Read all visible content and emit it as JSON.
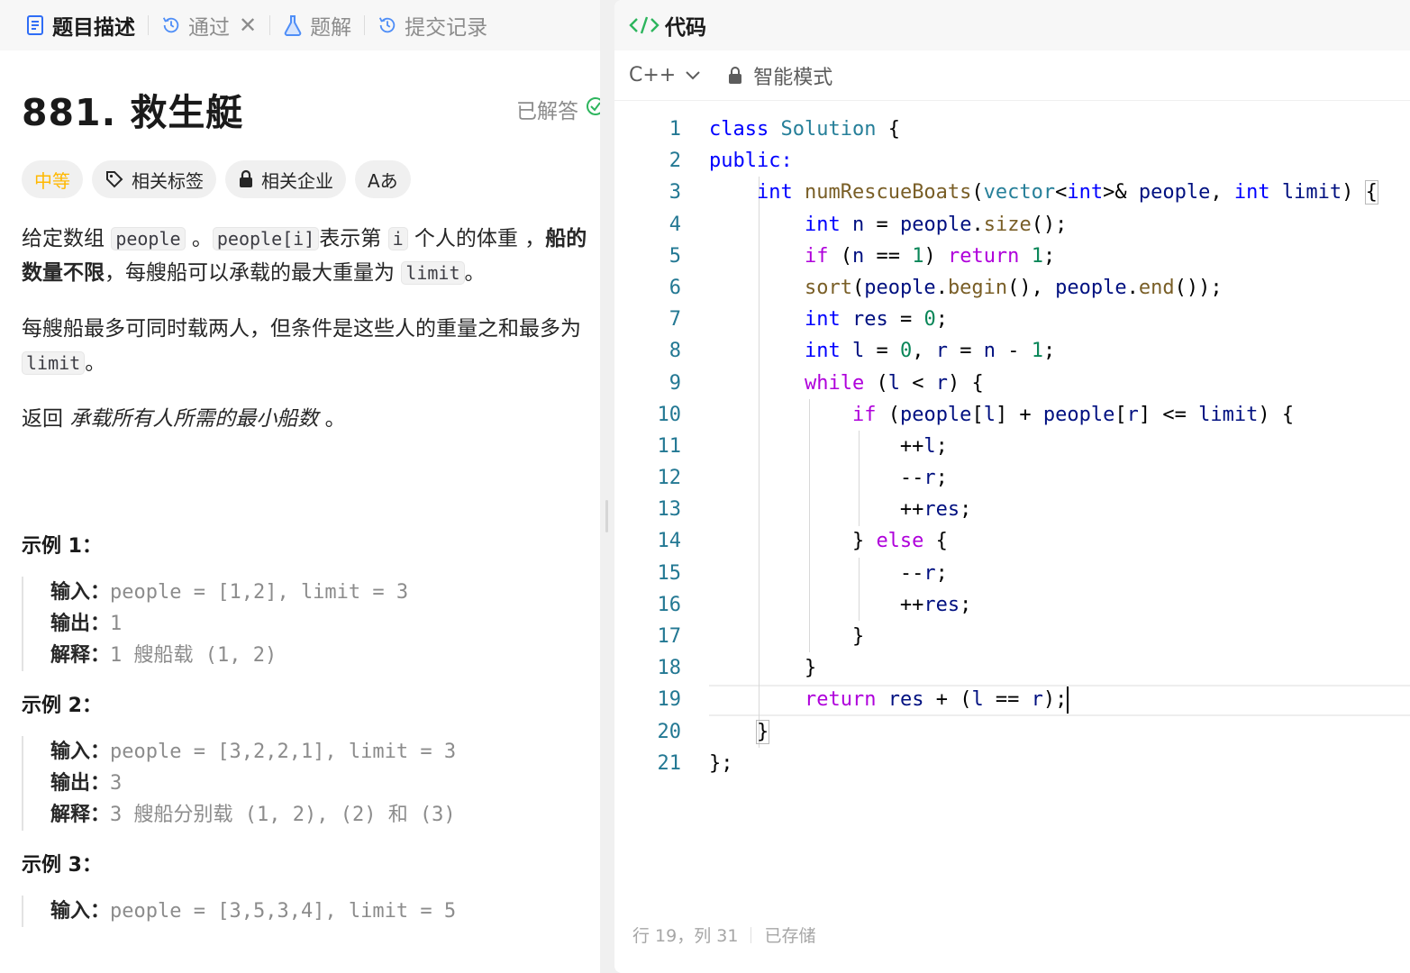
{
  "tabs": [
    {
      "label": "题目描述",
      "icon": "doc-icon"
    },
    {
      "label": "通过",
      "icon": "history-icon"
    },
    {
      "label": "题解",
      "icon": "flask-icon"
    },
    {
      "label": "提交记录",
      "icon": "history-icon"
    }
  ],
  "problem": {
    "title": "881. 救生艇",
    "status": "已解答",
    "difficulty": "中等",
    "tags": [
      "相关标签",
      "相关企业"
    ],
    "translate_icon": "Aあ"
  },
  "description": {
    "p1_a": "给定数组 ",
    "p1_code1": "people",
    "p1_b": " 。",
    "p1_code2": "people[i]",
    "p1_c": "表示第 ",
    "p1_code3": "i",
    "p1_d": " 个人的体重 ，",
    "p1_bold": "船的数量不限",
    "p1_e": "，每艘船可以承载的最大重量为 ",
    "p1_code4": "limit",
    "p1_f": "。",
    "p2_a": "每艘船最多可同时载两人，但条件是这些人的重量之和最多为 ",
    "p2_code": "limit",
    "p2_b": "。",
    "p3_a": "返回 ",
    "p3_italic": "承载所有人所需的最小船数",
    "p3_b": " 。"
  },
  "examples": [
    {
      "title": "示例 1：",
      "input_label": "输入：",
      "input": "people = [1,2], limit = 3",
      "output_label": "输出：",
      "output": "1",
      "explain_label": "解释：",
      "explain": "1 艘船载 (1, 2)"
    },
    {
      "title": "示例 2：",
      "input_label": "输入：",
      "input": "people = [3,2,2,1], limit = 3",
      "output_label": "输出：",
      "output": "3",
      "explain_label": "解释：",
      "explain": "3 艘船分别载 (1, 2), (2) 和 (3)"
    },
    {
      "title": "示例 3：",
      "input_label": "输入：",
      "input": "people = [3,5,3,4], limit = 5"
    }
  ],
  "editor": {
    "header": "代码",
    "language": "C++",
    "mode": "智能模式",
    "line_numbers": [
      "1",
      "2",
      "3",
      "4",
      "5",
      "6",
      "7",
      "8",
      "9",
      "10",
      "11",
      "12",
      "13",
      "14",
      "15",
      "16",
      "17",
      "18",
      "19",
      "20",
      "21"
    ],
    "status_position": "行 19，列 31",
    "status_saved": "已存储"
  }
}
